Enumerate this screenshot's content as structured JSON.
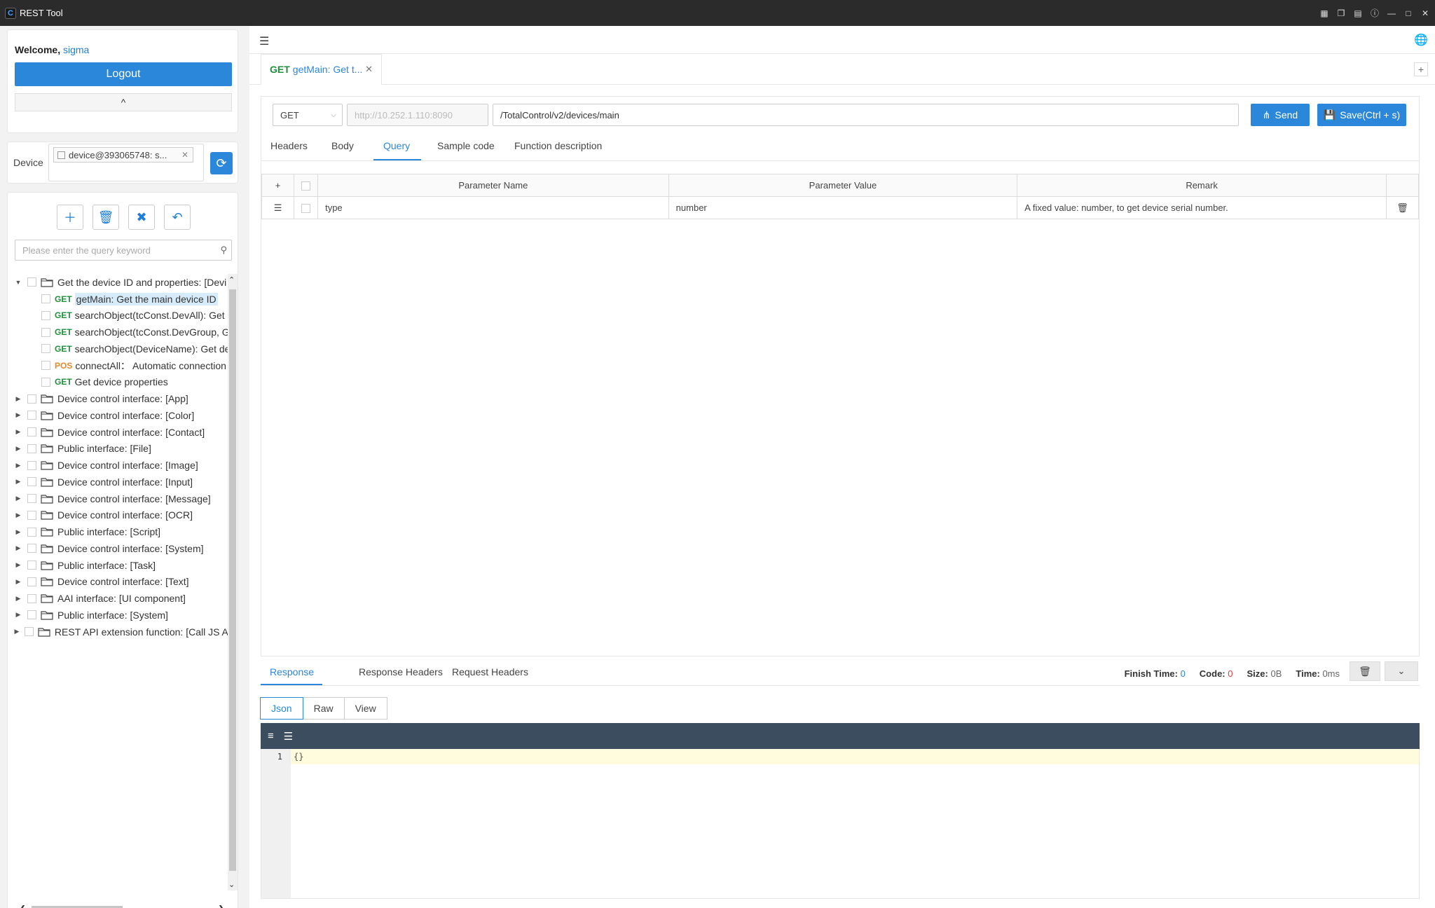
{
  "window": {
    "title": "REST Tool",
    "logo_letter": "C"
  },
  "sidebar": {
    "welcome_prefix": "Welcome,",
    "username": "sigma",
    "logout_label": "Logout",
    "collapse_glyph": "^",
    "device_label": "Device",
    "device_tag": "device@393065748: s...",
    "search_placeholder": "Please enter the query keyword",
    "tree": [
      {
        "label": "Get the device ID and properties: [Devi",
        "expanded": true,
        "children": [
          {
            "method": "GET",
            "label": "getMain: Get the main device ID",
            "selected": true
          },
          {
            "method": "GET",
            "label": "searchObject(tcConst.DevAll): Get a"
          },
          {
            "method": "GET",
            "label": "searchObject(tcConst.DevGroup, G"
          },
          {
            "method": "GET",
            "label": "searchObject(DeviceName): Get de"
          },
          {
            "method": "POS",
            "label": "connectAll： Automatic connection"
          },
          {
            "method": "GET",
            "label": "Get device properties"
          }
        ]
      },
      {
        "label": "Device control interface: [App]"
      },
      {
        "label": "Device control interface: [Color]"
      },
      {
        "label": "Device control interface: [Contact]"
      },
      {
        "label": "Public interface: [File]"
      },
      {
        "label": "Device control interface: [Image]"
      },
      {
        "label": "Device control interface: [Input]"
      },
      {
        "label": "Device control interface: [Message]"
      },
      {
        "label": "Device control interface: [OCR]"
      },
      {
        "label": "Public interface: [Script]"
      },
      {
        "label": "Device control interface: [System]"
      },
      {
        "label": "Public interface: [Task]"
      },
      {
        "label": "Device control interface: [Text]"
      },
      {
        "label": "AAI interface: [UI component]"
      },
      {
        "label": "Public interface: [System]"
      },
      {
        "label": "REST API extension function: [Call JS Al"
      }
    ]
  },
  "request": {
    "tab_method": "GET",
    "tab_label": "getMain: Get t...",
    "method": "GET",
    "host": "http://10.252.1.110:8090",
    "path": "/TotalControl/v2/devices/main",
    "send_label": "Send",
    "save_label": "Save(Ctrl + s)",
    "tabs": [
      "Headers",
      "Body",
      "Query",
      "Sample code",
      "Function description"
    ],
    "active_tab": "Query",
    "table": {
      "headers": [
        "Parameter Name",
        "Parameter Value",
        "Remark"
      ],
      "rows": [
        {
          "name": "type",
          "value": "number",
          "remark": "A fixed value: number, to get device serial number."
        }
      ]
    }
  },
  "response": {
    "tabs": [
      "Response",
      "Response Headers",
      "Request Headers"
    ],
    "active_tab": "Response",
    "finish_time_label": "Finish Time:",
    "finish_time": "0",
    "code_label": "Code:",
    "code": "0",
    "size_label": "Size:",
    "size": "0B",
    "time_label": "Time:",
    "time": "0ms",
    "view_modes": [
      "Json",
      "Raw",
      "View"
    ],
    "active_view": "Json",
    "line_number": "1",
    "body": "{}"
  }
}
